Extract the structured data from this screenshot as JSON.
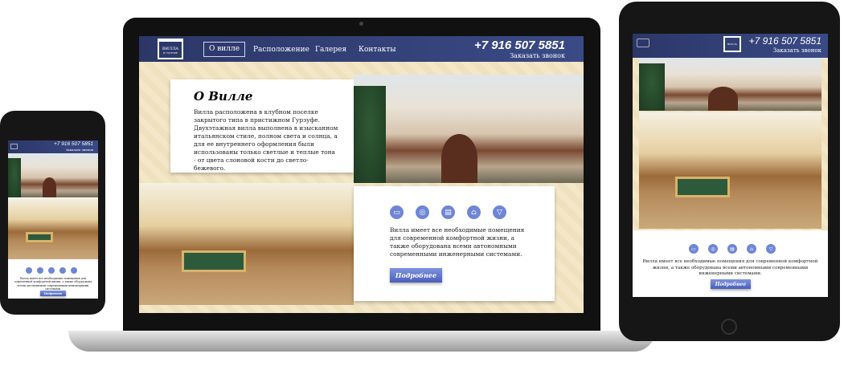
{
  "logo": {
    "line1": "ВИЛЛА",
    "line2": "В ГУРЗУФЕ"
  },
  "nav": [
    {
      "label": "О вилле",
      "active": true
    },
    {
      "label": "Расположение"
    },
    {
      "label": "Галерея"
    },
    {
      "label": "Контакты"
    }
  ],
  "contact": {
    "phone": "+7 916 507 5851",
    "callback": "Заказать звонок"
  },
  "about": {
    "title": "О Вилле",
    "text": "Вилла расположена в клубном поселке закрытого типа в пристижном Гурзуфе. Двухэтажная вилла выполнена в изысканном итальянском стиле, полном света и солнца, а для ее внутреннего оформления были использованы только светлые и теплые тона - от цвета слоновой кости до светло-бежевого."
  },
  "features": {
    "icons": [
      "bed-icon",
      "boiler-icon",
      "oven-icon",
      "car-icon",
      "cocktail-icon"
    ],
    "text": "Вилла имеет все необходимые помещения для современной комфортной жизни, а также оборудована всеми автономными современными инженерными системами.",
    "button": "Подробнее"
  },
  "colors": {
    "header": "#2c3768",
    "accent": "#6f86d6",
    "background": "#efe1bd"
  }
}
